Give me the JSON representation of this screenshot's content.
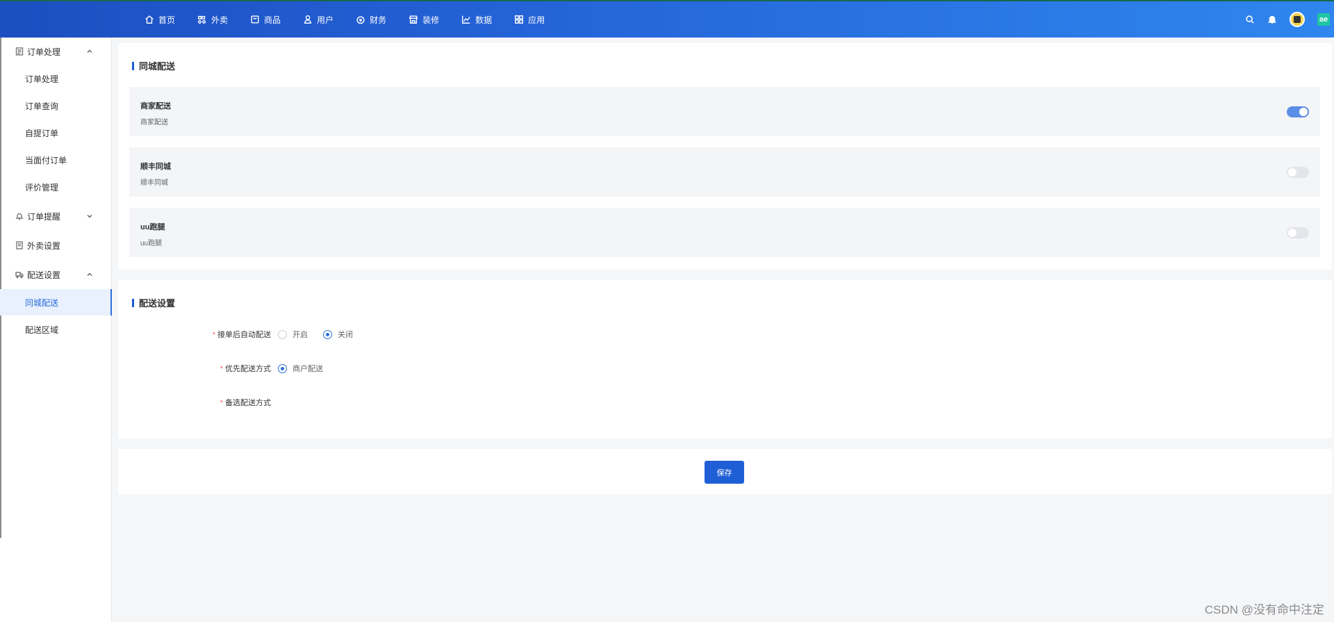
{
  "topnav": {
    "items": [
      {
        "label": "首页",
        "icon": "home-icon"
      },
      {
        "label": "外卖",
        "icon": "bike-icon"
      },
      {
        "label": "商品",
        "icon": "bag-icon"
      },
      {
        "label": "用户",
        "icon": "user-icon"
      },
      {
        "label": "财务",
        "icon": "money-icon"
      },
      {
        "label": "装修",
        "icon": "store-icon"
      },
      {
        "label": "数据",
        "icon": "chart-icon"
      },
      {
        "label": "应用",
        "icon": "grid-icon"
      }
    ],
    "brand_mark": "ae"
  },
  "sidebar": {
    "group_order": "订单处理",
    "items_order": [
      "订单处理",
      "订单查询",
      "自提订单",
      "当面付订单",
      "评价管理"
    ],
    "group_reminder": "订单提醒",
    "group_takeout": "外卖设置",
    "group_delivery": "配送设置",
    "items_delivery": [
      "同城配送",
      "配送区域"
    ]
  },
  "city_delivery": {
    "title": "同城配送",
    "options": [
      {
        "name": "商家配送",
        "desc": "商家配送",
        "enabled": true
      },
      {
        "name": "顺丰同城",
        "desc": "顺丰同城",
        "enabled": false
      },
      {
        "name": "uu跑腿",
        "desc": "uu跑腿",
        "enabled": false
      }
    ]
  },
  "delivery_settings": {
    "title": "配送设置",
    "auto_label": "接单后自动配送",
    "auto_options": [
      "开启",
      "关闭"
    ],
    "auto_selected": "关闭",
    "priority_label": "优先配送方式",
    "priority_options": [
      "商户配送"
    ],
    "priority_selected": "商户配送",
    "backup_label": "备选配送方式",
    "required_mark": "*"
  },
  "actions": {
    "save_label": "保存"
  },
  "watermark": "CSDN @没有命中注定",
  "colors": {
    "primary": "#1f5fd6",
    "switch_on": "#5b8ee6",
    "required": "#f56c6c"
  }
}
